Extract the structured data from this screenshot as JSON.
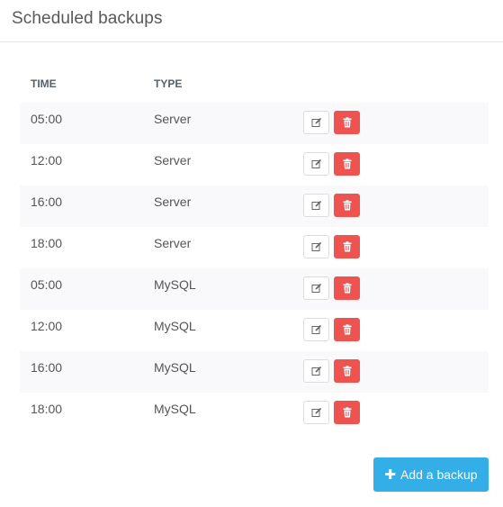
{
  "panel": {
    "title": "Scheduled backups"
  },
  "table": {
    "headers": {
      "time": "TIME",
      "type": "TYPE"
    },
    "rows": [
      {
        "time": "05:00",
        "type": "Server"
      },
      {
        "time": "12:00",
        "type": "Server"
      },
      {
        "time": "16:00",
        "type": "Server"
      },
      {
        "time": "18:00",
        "type": "Server"
      },
      {
        "time": "05:00",
        "type": "MySQL"
      },
      {
        "time": "12:00",
        "type": "MySQL"
      },
      {
        "time": "16:00",
        "type": "MySQL"
      },
      {
        "time": "18:00",
        "type": "MySQL"
      }
    ],
    "row_actions": {
      "edit_icon": "edit-icon",
      "delete_icon": "trash-icon"
    }
  },
  "add_button": {
    "label": "Add a backup",
    "icon": "plus-icon"
  },
  "colors": {
    "delete": "#ef5350",
    "primary": "#33aee6",
    "stripe": "#f9f9fb"
  }
}
